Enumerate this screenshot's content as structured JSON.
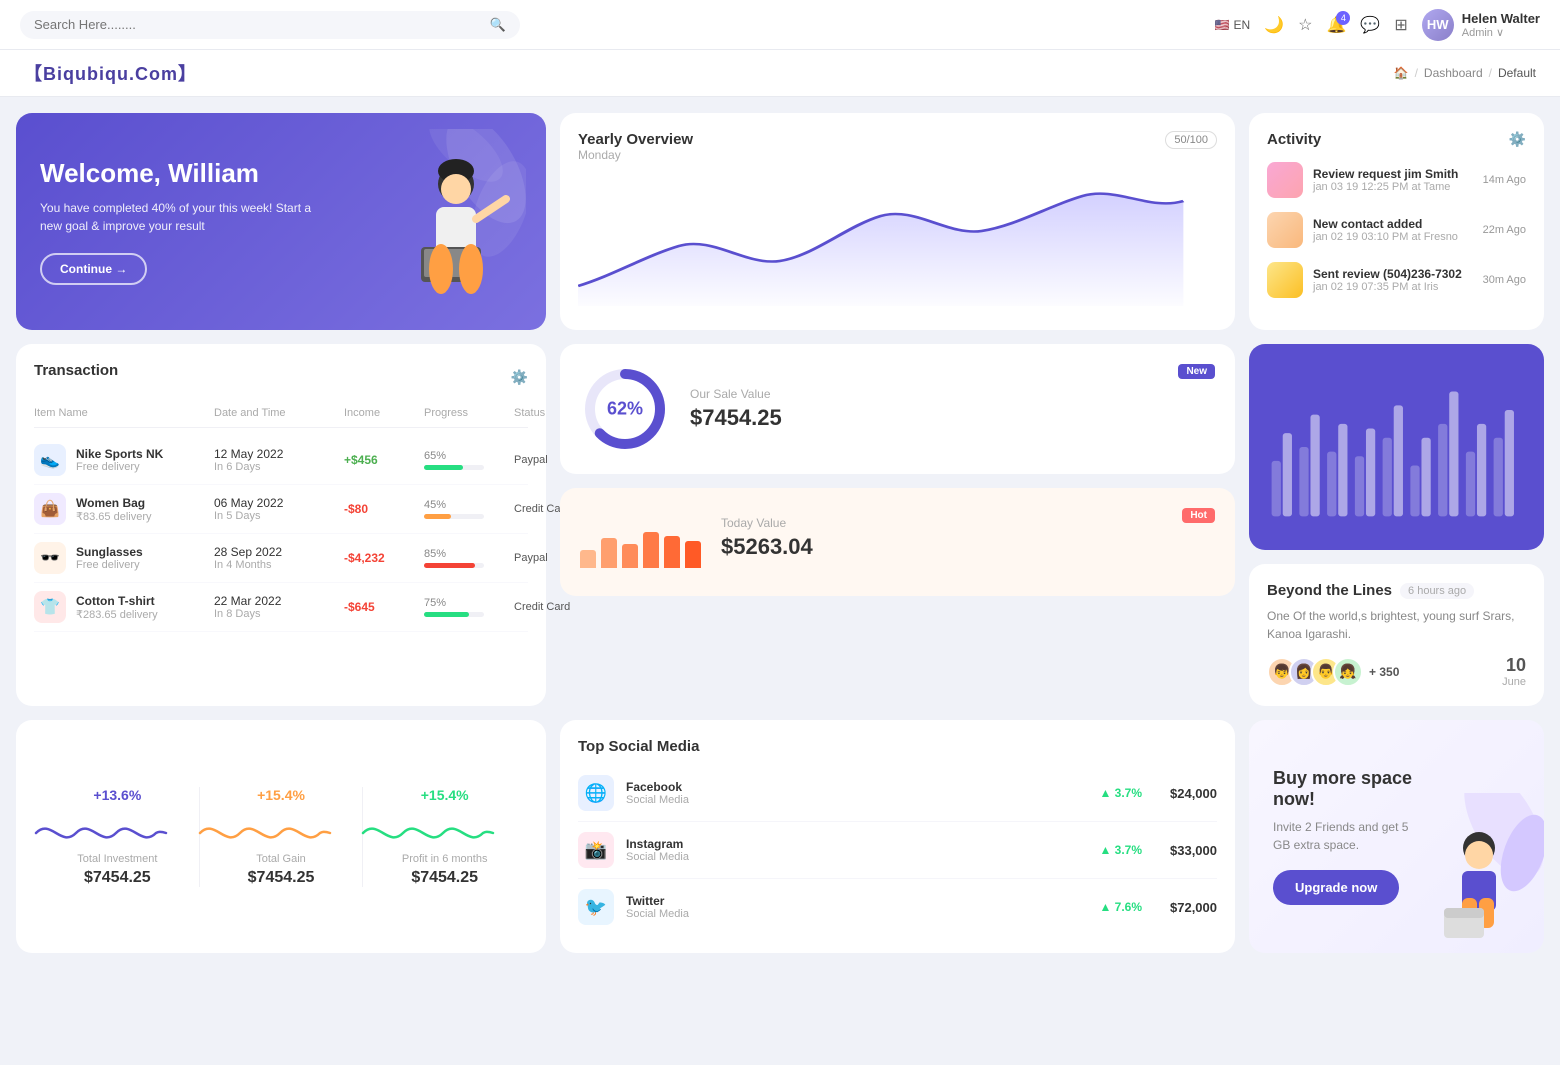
{
  "nav": {
    "search_placeholder": "Search Here........",
    "lang": "EN",
    "user": {
      "name": "Helen Walter",
      "role": "Admin"
    },
    "notifications_count": "4"
  },
  "breadcrumb": {
    "brand": "【Biqubiqu.Com】",
    "home": "🏠",
    "dashboard": "Dashboard",
    "current": "Default"
  },
  "welcome": {
    "title": "Welcome, William",
    "subtitle": "You have completed 40% of your this week! Start a new goal & improve your result",
    "button": "Continue →"
  },
  "yearly_overview": {
    "title": "Yearly Overview",
    "sub": "Monday",
    "badge": "50/100"
  },
  "activity": {
    "title": "Activity",
    "items": [
      {
        "name": "Review request jim Smith",
        "when": "jan 03 19 12:25 PM at Tame",
        "time": "14m Ago",
        "color": "pink"
      },
      {
        "name": "New contact added",
        "when": "jan 02 19 03:10 PM at Fresno",
        "time": "22m Ago",
        "color": "peach"
      },
      {
        "name": "Sent review (504)236-7302",
        "when": "jan 02 19 07:35 PM at Iris",
        "time": "30m Ago",
        "color": "gold"
      }
    ]
  },
  "transaction": {
    "title": "Transaction",
    "columns": [
      "Item Name",
      "Date and Time",
      "Income",
      "Progress",
      "Status"
    ],
    "rows": [
      {
        "icon": "👟",
        "icon_bg": "blue",
        "name": "Nike Sports NK",
        "sub": "Free delivery",
        "date": "12 May 2022",
        "days": "In 6 Days",
        "income": "+$456",
        "income_type": "pos",
        "progress": 65,
        "bar_color": "#26de81",
        "status": "Paypal"
      },
      {
        "icon": "👜",
        "icon_bg": "purple",
        "name": "Women Bag",
        "sub": "₹83.65 delivery",
        "date": "06 May 2022",
        "days": "In 5 Days",
        "income": "-$80",
        "income_type": "neg",
        "progress": 45,
        "bar_color": "#ff9f43",
        "status": "Credit Card"
      },
      {
        "icon": "🕶️",
        "icon_bg": "orange",
        "name": "Sunglasses",
        "sub": "Free delivery",
        "date": "28 Sep 2022",
        "days": "In 4 Months",
        "income": "-$4,232",
        "income_type": "neg",
        "progress": 85,
        "bar_color": "#f44336",
        "status": "Paypal"
      },
      {
        "icon": "👕",
        "icon_bg": "red",
        "name": "Cotton T-shirt",
        "sub": "₹283.65 delivery",
        "date": "22 Mar 2022",
        "days": "In 8 Days",
        "income": "-$645",
        "income_type": "neg",
        "progress": 75,
        "bar_color": "#26de81",
        "status": "Credit Card"
      }
    ]
  },
  "sale_value": {
    "badge": "New",
    "percent": "62%",
    "label": "Our Sale Value",
    "value": "$7454.25",
    "donut_pct": 62
  },
  "today_value": {
    "badge": "Hot",
    "label": "Today Value",
    "value": "$5263.04",
    "bars": [
      30,
      50,
      40,
      60,
      55,
      45
    ]
  },
  "bar_chart": {
    "groups": [
      [
        40,
        60
      ],
      [
        55,
        80
      ],
      [
        50,
        70
      ],
      [
        45,
        65
      ],
      [
        60,
        85
      ],
      [
        35,
        55
      ],
      [
        70,
        90
      ],
      [
        45,
        65
      ],
      [
        55,
        80
      ],
      [
        65,
        95
      ]
    ]
  },
  "beyond": {
    "title": "Beyond the Lines",
    "time": "6 hours ago",
    "desc": "One Of the world,s brightest, young surf Srars, Kanoa Igarashi.",
    "plus_count": "+ 350",
    "date": "10",
    "month": "June"
  },
  "stats": [
    {
      "pct": "+13.6%",
      "color": "blue",
      "label": "Total Investment",
      "value": "$7454.25",
      "wave_color": "#5a4fcf"
    },
    {
      "pct": "+15.4%",
      "color": "orange",
      "label": "Total Gain",
      "value": "$7454.25",
      "wave_color": "#ff9f43"
    },
    {
      "pct": "+15.4%",
      "color": "green",
      "label": "Profit in 6 months",
      "value": "$7454.25",
      "wave_color": "#26de81"
    }
  ],
  "social": {
    "title": "Top Social Media",
    "items": [
      {
        "name": "Facebook",
        "type": "Social Media",
        "growth": "3.7%",
        "amount": "$24,000",
        "platform": "fb"
      },
      {
        "name": "Instagram",
        "type": "Social Media",
        "growth": "3.7%",
        "amount": "$33,000",
        "platform": "ig"
      },
      {
        "name": "Twitter",
        "type": "Social Media",
        "growth": "7.6%",
        "amount": "$72,000",
        "platform": "tw"
      }
    ]
  },
  "buy_space": {
    "title": "Buy more space now!",
    "desc": "Invite 2 Friends and get 5 GB extra space.",
    "button": "Upgrade now"
  }
}
